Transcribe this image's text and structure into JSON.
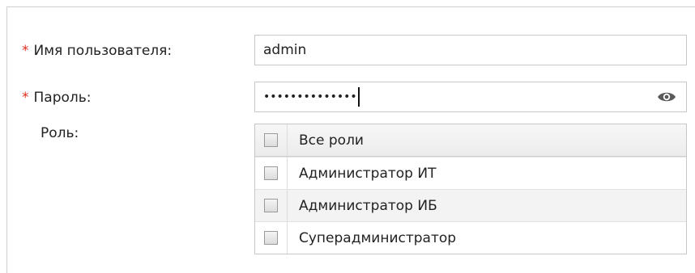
{
  "form": {
    "username_required": "*",
    "username_label": "Имя пользователя:",
    "username_value": "admin",
    "password_required": "*",
    "password_label": "Пароль:",
    "password_value": "••••••••••••••",
    "role_label": "Роль:",
    "roles": [
      {
        "label": "Все роли",
        "checked": false
      },
      {
        "label": "Администратор ИТ",
        "checked": false
      },
      {
        "label": "Администратор ИБ",
        "checked": false
      },
      {
        "label": "Суперадминистратор",
        "checked": false
      }
    ]
  },
  "icons": {
    "password_toggle": "eye-icon"
  },
  "colors": {
    "required": "#e0301e"
  }
}
